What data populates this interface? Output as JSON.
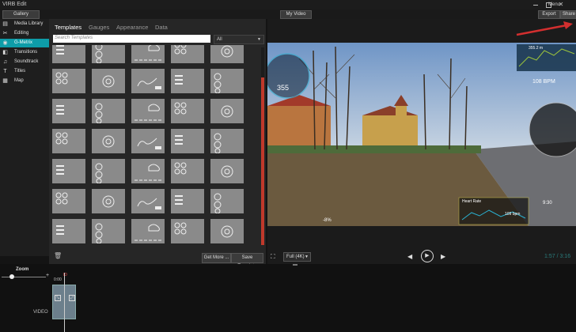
{
  "window": {
    "title": "VIRB Edit",
    "menu_label": "Menu"
  },
  "toolbar": {
    "gallery": "Gallery",
    "project": "My Video",
    "export": "Export",
    "share": "Share"
  },
  "sidebar": {
    "items": [
      {
        "label": "Media Library",
        "icon": "film-icon"
      },
      {
        "label": "Editing",
        "icon": "scissors-icon"
      },
      {
        "label": "G-Metrix",
        "icon": "eye-icon",
        "active": true
      },
      {
        "label": "Transitions",
        "icon": "transition-icon"
      },
      {
        "label": "Soundtrack",
        "icon": "music-note-icon"
      },
      {
        "label": "Titles",
        "icon": "title-icon"
      },
      {
        "label": "Map",
        "icon": "map-icon"
      }
    ]
  },
  "templates": {
    "tabs": [
      "Templates",
      "Gauges",
      "Appearance",
      "Data"
    ],
    "search_placeholder": "Search Templates",
    "filter_value": "All",
    "get_more": "Get More ...",
    "save_template": "Save Template"
  },
  "preview": {
    "overlay_speed": "355",
    "overlay_dist": "355.2 m",
    "overlay_hr": "108 BPM",
    "overlay_heart_title": "Heart Rate",
    "overlay_heart_val": "109 bpm",
    "overlay_grade": "-8%",
    "overlay_time": "9:30",
    "quality": "Full (4K)",
    "timecode": "1:57 / 3:16"
  },
  "timeline": {
    "zoom_label": "Zoom",
    "tick": "0:00",
    "track_label": "VIDEO"
  },
  "colors": {
    "accent": "#0e9ca8",
    "scroll": "#c0392b",
    "arrow": "#d32f2f"
  }
}
